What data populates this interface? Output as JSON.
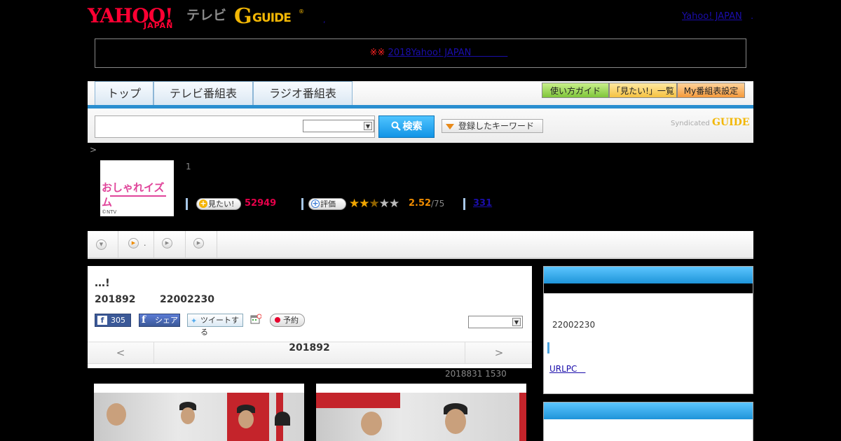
{
  "header": {
    "logo_yahoo": "YAHOO!",
    "logo_japan": "JAPAN",
    "logo_tv": "テレビ",
    "logo_g": "G",
    "logo_guide": "GUIDE",
    "logo_reg": "®",
    "comma": ",",
    "yahoo_japan_link": "Yahoo! JAPAN",
    "dot": "."
  },
  "notice": {
    "marks": "※※",
    "link": "2018Yahoo! JAPAN　　　　"
  },
  "nav": {
    "tabs": [
      {
        "label": "トップ"
      },
      {
        "label": "テレビ番組表"
      },
      {
        "label": "ラジオ番組表"
      }
    ],
    "buttons": {
      "guide": "使い方ガイド",
      "want_list": "「見たい!」一覧",
      "my_schedule": "My番組表設定"
    }
  },
  "search": {
    "value": "",
    "select_value": "",
    "button_label": "検索",
    "keyword_label": "登録したキーワード",
    "syndicated": "Syndicated",
    "syndicated_logo": "GUIDE",
    "search_icon": "search-icon"
  },
  "breadcrumb": ">",
  "program": {
    "thumb_title": "おしゃれイズム",
    "thumb_copyright": "©NTV",
    "episode": "1",
    "want_label": "見たい!",
    "want_count": "52949",
    "rate_label": "評価",
    "rating": 2.52,
    "rate_score": "2.52",
    "rate_count": "/75",
    "review_link": "331",
    "stars_on": "★★",
    "stars_half": "★",
    "stars_off": "★★"
  },
  "tab_strip": {
    "item2_label": "."
  },
  "main": {
    "title": "…!",
    "date": "201892",
    "time": "22002230",
    "fb_like_count": "305",
    "fb_share": "シェア",
    "tweet": "ツイートする",
    "reserve": "予約",
    "select_value": "",
    "pager_prev": "<",
    "pager_date": "201892",
    "pager_next": ">"
  },
  "updated": "2018831  1530",
  "sidebar": {
    "time": "22002230",
    "url_link": "URLPC　"
  },
  "colors": {
    "accent_blue": "#1e94d9",
    "want_red": "#e6004a",
    "rating_orange": "#f08c00"
  }
}
